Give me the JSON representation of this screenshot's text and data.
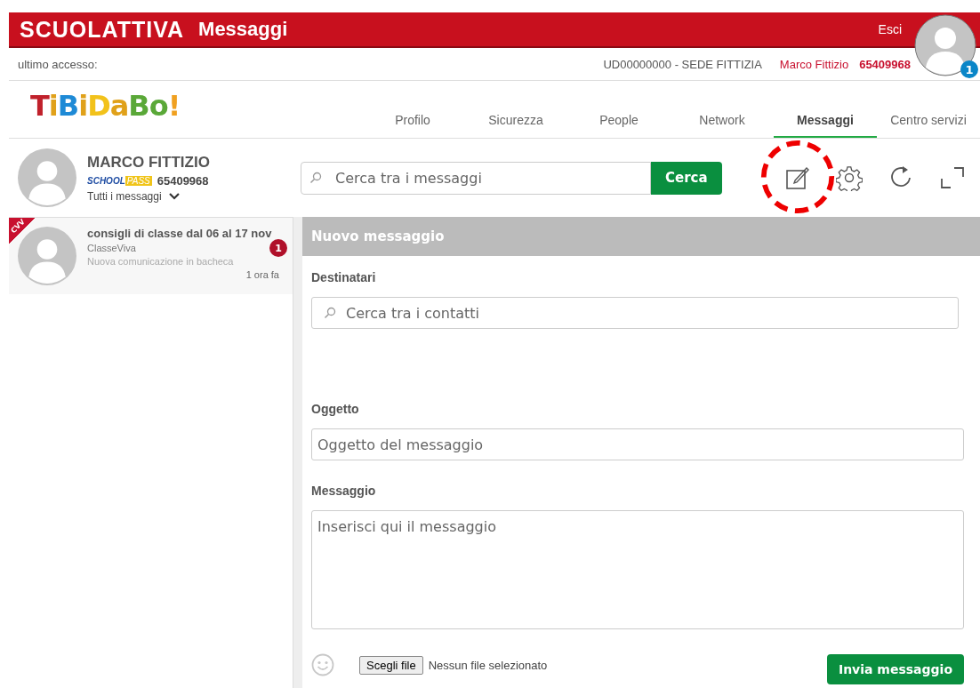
{
  "header": {
    "logo": "SCUOLATTIVA",
    "title": "Messaggi",
    "logout": "Esci",
    "notifications": "1"
  },
  "info_bar": {
    "last_access": "ultimo accesso:",
    "school": "UD00000000 - SEDE FITTIZIA",
    "user": "Marco Fittizio",
    "code": "65409968"
  },
  "brand": "TiBiDaBo!",
  "tabs": [
    {
      "label": "Profilo",
      "selected": false
    },
    {
      "label": "Sicurezza",
      "selected": false
    },
    {
      "label": "People",
      "selected": false
    },
    {
      "label": "Network",
      "selected": false
    },
    {
      "label": "Messaggi",
      "selected": true
    },
    {
      "label": "Centro servizi",
      "selected": false
    }
  ],
  "profile": {
    "name": "MARCO FITTIZIO",
    "pass_left": "SCHOOL",
    "pass_right": "PASS",
    "code": "65409968",
    "filter": "Tutti i messaggi"
  },
  "search": {
    "placeholder": "Cerca tra i messaggi",
    "button": "Cerca"
  },
  "messages": [
    {
      "ribbon": "CVV",
      "title": "consigli di classe dal 06 al 17 nov",
      "sender": "ClasseViva",
      "preview": "Nuova comunicazione in bacheca",
      "time": "1 ora fa",
      "unread": "1"
    }
  ],
  "compose": {
    "title": "Nuovo messaggio",
    "recipients_label": "Destinatari",
    "recipients_placeholder": "Cerca tra i contatti",
    "subject_label": "Oggetto",
    "subject_placeholder": "Oggetto del messaggio",
    "message_label": "Messaggio",
    "message_placeholder": "Inserisci qui il messaggio",
    "file_button": "Scegli file",
    "file_status": "Nessun file selezionato",
    "send": "Invia messaggio"
  }
}
